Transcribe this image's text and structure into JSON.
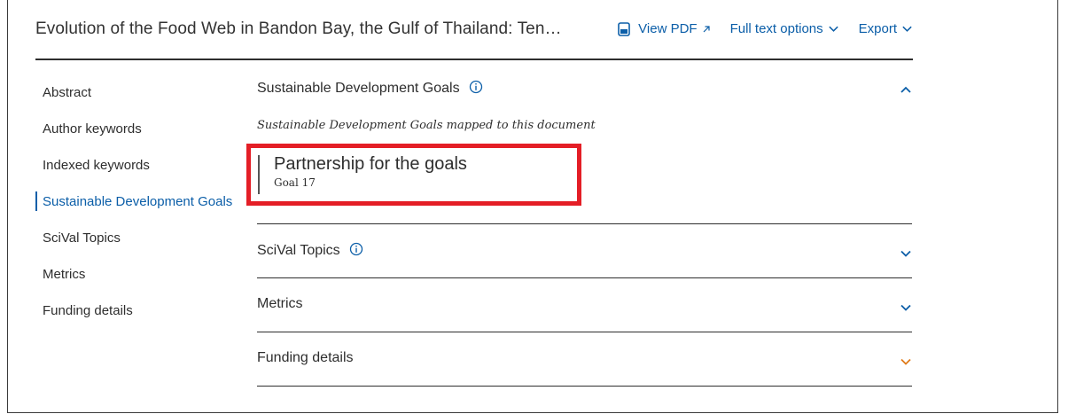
{
  "header": {
    "title": "Evolution of the Food Web in Bandon Bay, the Gulf of Thailand: Ten…",
    "view_pdf": "View PDF",
    "full_text_options": "Full text options",
    "export": "Export"
  },
  "sidebar": {
    "items": [
      {
        "label": "Abstract"
      },
      {
        "label": "Author keywords"
      },
      {
        "label": "Indexed keywords"
      },
      {
        "label": "Sustainable Development Goals",
        "active": true
      },
      {
        "label": "SciVal Topics"
      },
      {
        "label": "Metrics"
      },
      {
        "label": "Funding details"
      }
    ]
  },
  "sections": {
    "sdg": {
      "title": "Sustainable Development Goals",
      "subtitle": "Sustainable Development Goals mapped to this document",
      "goal_title": "Partnership for the goals",
      "goal_number": "Goal 17"
    },
    "scival": {
      "title": "SciVal Topics"
    },
    "metrics": {
      "title": "Metrics"
    },
    "funding": {
      "title": "Funding details"
    }
  },
  "colors": {
    "link": "#0b5ea8",
    "highlight_box": "#e41e26",
    "funding_chevron": "#e07b1a"
  },
  "icons": {
    "pdf": "pdf-file-icon",
    "external": "external-arrow-icon",
    "dropdown": "chevron-down-icon",
    "info": "info-icon",
    "collapse": "chevron-up-icon"
  }
}
